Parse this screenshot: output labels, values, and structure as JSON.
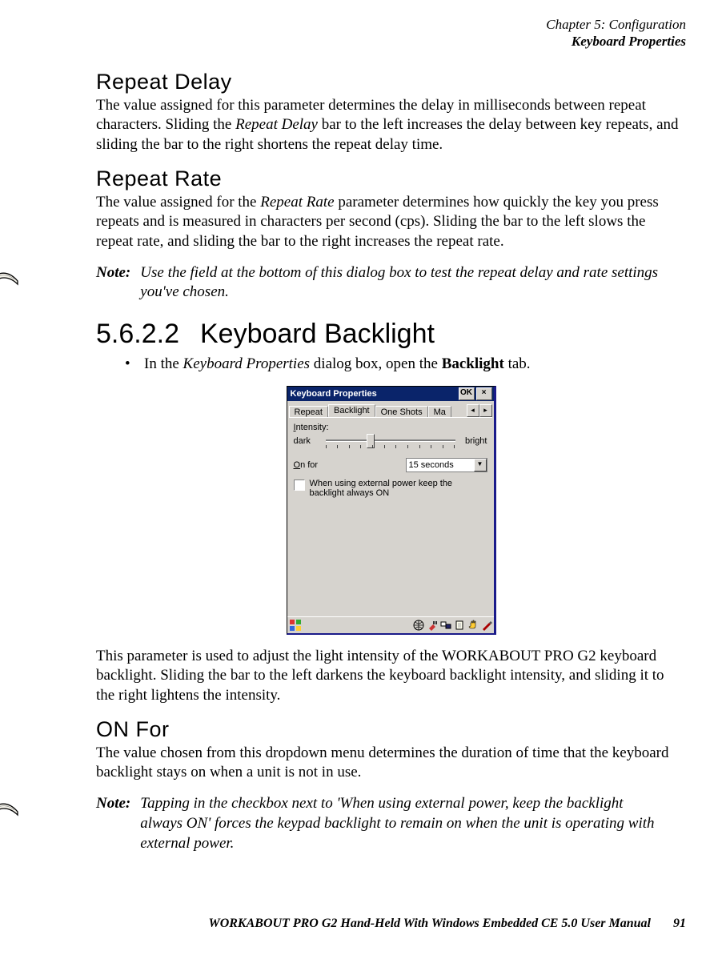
{
  "header": {
    "chapter": "Chapter 5: Configuration",
    "section": "Keyboard Properties"
  },
  "s1": {
    "heading": "Repeat Delay",
    "p_pre": "The value assigned for this parameter determines the delay in milliseconds between repeat characters. Sliding the ",
    "p_em": "Repeat Delay",
    "p_post": " bar to the left increases the delay between key repeats, and sliding the bar to the right shortens the repeat delay time."
  },
  "s2": {
    "heading": "Repeat Rate",
    "p_pre": "The value assigned for the ",
    "p_em": "Repeat Rate",
    "p_post": " parameter determines how quickly the key you press repeats and is measured in characters per second (cps). Sliding the bar to the left slows the repeat rate, and sliding the bar to the right increases the repeat rate."
  },
  "note1": {
    "label": "Note:",
    "text": "Use the field at the bottom of this dialog box to test the repeat delay and rate settings you've chosen."
  },
  "s3": {
    "number": "5.6.2.2",
    "title": "Keyboard Backlight",
    "bullet_pre": "In the ",
    "bullet_em": "Keyboard Properties",
    "bullet_mid": " dialog box, open the ",
    "bullet_strong": "Backlight",
    "bullet_post": " tab."
  },
  "dialog": {
    "title": "Keyboard Properties",
    "ok": "OK",
    "close": "×",
    "tabs": {
      "repeat": "Repeat",
      "backlight": "Backlight",
      "oneshots": "One Shots",
      "macro": "Ma"
    },
    "arrows": {
      "left": "◂",
      "right": "▸"
    },
    "intensity_label": "Intensity:",
    "intensity_i": "I",
    "dark": "dark",
    "bright": "bright",
    "onfor_o": "O",
    "onfor_rest": "n for",
    "dropdown_value": "15 seconds",
    "dd_arrow": "▼",
    "checkbox_text": "When using external power keep the backlight always ON"
  },
  "s4": {
    "p": "This parameter is used to adjust the light intensity of the WORKABOUT PRO G2 keyboard backlight. Sliding the bar to the left darkens the keyboard backlight intensity, and sliding it to the right lightens the intensity."
  },
  "s5": {
    "heading": "ON For",
    "p": "The value chosen from this dropdown menu determines the duration of time that the keyboard backlight stays on when a unit is not in use."
  },
  "note2": {
    "label": "Note:",
    "text": "Tapping in the checkbox next to 'When using external power, keep the backlight always ON' forces the keypad backlight to remain on when the unit is operating with external power."
  },
  "footer": {
    "text": "WORKABOUT PRO G2 Hand-Held With Windows Embedded CE 5.0 User Manual",
    "page": "91"
  }
}
